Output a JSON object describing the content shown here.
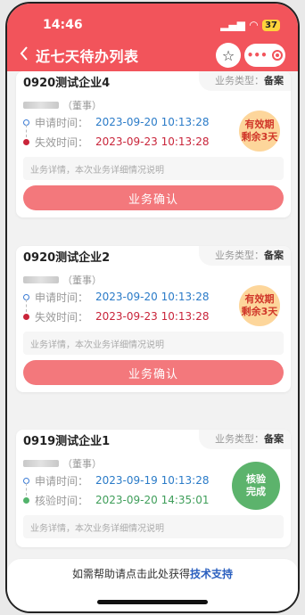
{
  "status_bar": {
    "time": "14:46",
    "signal": "▂▄▆",
    "wifi": "◠",
    "battery": "37"
  },
  "header": {
    "back_icon": "chevron-left",
    "title": "近七天待办列表",
    "star_icon": "☆",
    "more_dots": "•••"
  },
  "cards": [
    {
      "company": "0920测试企业4",
      "type_label": "业务类型：",
      "type_value": "备案",
      "role": "（董事）",
      "apply_label": "申请时间：",
      "apply_time": "2023-09-20 10:13:28",
      "second_label": "失效时间：",
      "second_time": "2023-09-23 10:13:28",
      "badge_line1": "有效期",
      "badge_line2": "剩余3天",
      "detail": "业务详情，本次业务详细情况说明",
      "confirm": "业务确认"
    },
    {
      "company": "0920测试企业2",
      "type_label": "业务类型：",
      "type_value": "备案",
      "role": "（董事）",
      "apply_label": "申请时间：",
      "apply_time": "2023-09-20 10:13:28",
      "second_label": "失效时间：",
      "second_time": "2023-09-23 10:13:28",
      "badge_line1": "有效期",
      "badge_line2": "剩余3天",
      "detail": "业务详情，本次业务详细情况说明",
      "confirm": "业务确认"
    },
    {
      "company": "0919测试企业1",
      "type_label": "业务类型：",
      "type_value": "备案",
      "role": "（董事）",
      "apply_label": "申请时间：",
      "apply_time": "2023-09-19 10:13:28",
      "second_label": "核验时间：",
      "second_time": "2023-09-20 14:35:01",
      "badge_line1": "核验",
      "badge_line2": "完成",
      "detail": "业务详情，本次业务详细情况说明"
    }
  ],
  "footer": {
    "prefix": "如需帮助请点击此处获得",
    "link": "技术支持"
  },
  "colors": {
    "header_bg": "#f2545b",
    "confirm_bg": "#f3787c",
    "badge_orange": "#fdd69b",
    "badge_green": "#5cb36c"
  }
}
